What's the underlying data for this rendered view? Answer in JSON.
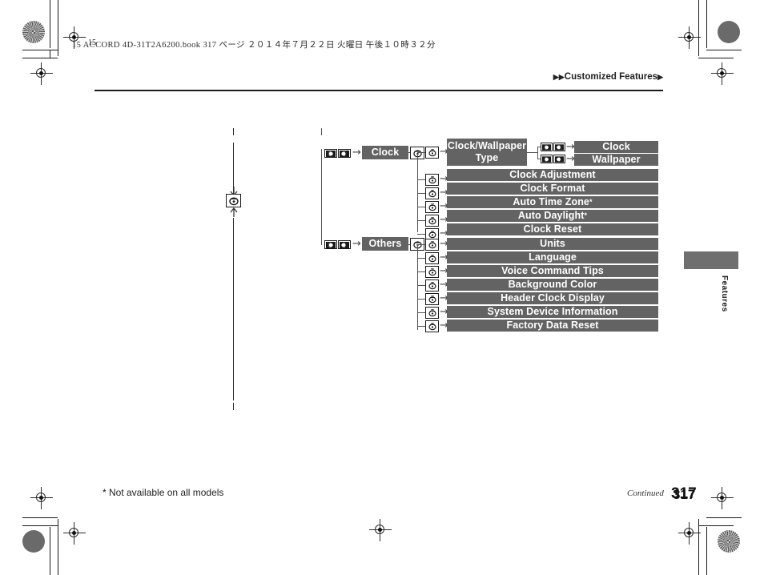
{
  "page": {
    "book_header": "15 ACCORD 4D-31T2A6200.book   317 ページ    ２０１４年７月２２日   火曜日   午後１０時３２分",
    "running_head": "Customized Features",
    "running_head_marker_left": "▶▶",
    "running_head_marker_right": "▶",
    "thumb_tab_label": "Features",
    "footnote": "* Not available on all models",
    "continued_label": "Continued",
    "folio": "317",
    "corner_folio": "317",
    "header_page_marker": "15"
  },
  "colors": {
    "node_fill": "#636363",
    "node_text": "#ffffff",
    "rule": "#1a1a1a",
    "tab_fill": "#6f6f6f",
    "connector": "#555555"
  },
  "diagram": {
    "type": "menu-tree",
    "icons": {
      "enter_knob": "knob-icon",
      "menu_button": "menu-button-icon",
      "selector_left": "selector-left-icon",
      "selector_right": "selector-right-icon",
      "arrow": "→"
    },
    "branches": [
      {
        "id": "clock",
        "label": "Clock",
        "items": [
          {
            "id": "clock-wallpaper-type",
            "label": "Clock/Wallpaper\nType",
            "label_line1": "Clock/Wallpaper",
            "label_line2": "Type",
            "children": [
              {
                "id": "clock-sub",
                "label": "Clock"
              },
              {
                "id": "wallpaper-sub",
                "label": "Wallpaper"
              }
            ]
          },
          {
            "id": "clock-adjustment",
            "label": "Clock Adjustment",
            "children": []
          },
          {
            "id": "clock-format",
            "label": "Clock Format",
            "children": []
          },
          {
            "id": "auto-time-zone",
            "label": "Auto Time Zone",
            "footnote_marker": "*",
            "children": []
          },
          {
            "id": "auto-daylight",
            "label": "Auto Daylight",
            "footnote_marker": "*",
            "children": []
          },
          {
            "id": "clock-reset",
            "label": "Clock Reset",
            "children": []
          }
        ]
      },
      {
        "id": "others",
        "label": "Others",
        "items": [
          {
            "id": "units",
            "label": "Units",
            "children": []
          },
          {
            "id": "language",
            "label": "Language",
            "children": []
          },
          {
            "id": "voice-command-tips",
            "label": "Voice Command Tips",
            "children": []
          },
          {
            "id": "background-color",
            "label": "Background Color",
            "children": []
          },
          {
            "id": "header-clock-display",
            "label": "Header Clock Display",
            "children": []
          },
          {
            "id": "system-device-information",
            "label": "System Device Information",
            "children": []
          },
          {
            "id": "factory-data-reset",
            "label": "Factory Data Reset",
            "children": []
          }
        ]
      }
    ]
  }
}
